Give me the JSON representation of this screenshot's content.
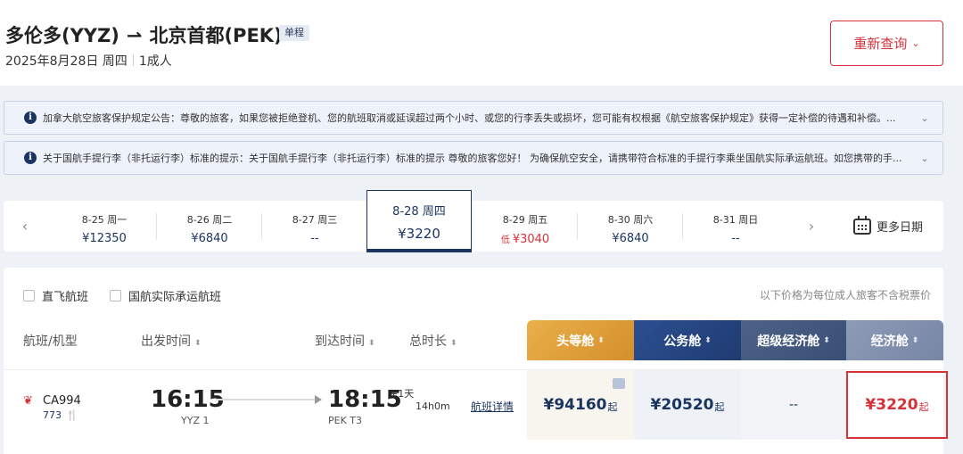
{
  "header": {
    "route_from": "多伦多(YYZ)",
    "route_arrow": "⇀",
    "route_to": "北京首都(PEK)",
    "trip_type": "单程",
    "date": "2025年8月28日 周四",
    "passengers": "1成人",
    "requery_label": "重新查询"
  },
  "notices": [
    {
      "text": "加拿大航空旅客保护规定公告：尊敬的旅客，如果您被拒绝登机、您的航班取消或延误超过两个小时、或您的行李丢失或损坏，您可能有权根据《航空旅客保护规定》获得一定补偿的待遇和补偿。..."
    },
    {
      "text": "关于国航手提行李（非托运行李）标准的提示：关于国航手提行李（非托运行李）标准的提示 尊敬的旅客您好！ 为确保航空安全，请携带符合标准的手提行李乘坐国航实际承运航班。如您携带的手..."
    }
  ],
  "dates": [
    {
      "label": "8-25 周一",
      "price": "¥12350",
      "low": false,
      "selected": false
    },
    {
      "label": "8-26 周二",
      "price": "¥6840",
      "low": false,
      "selected": false
    },
    {
      "label": "8-27 周三",
      "price": "--",
      "low": false,
      "selected": false
    },
    {
      "label": "8-28 周四",
      "price": "¥3220",
      "low": false,
      "selected": true
    },
    {
      "label": "8-29 周五",
      "price": "¥3040",
      "low": true,
      "low_tag": "低",
      "selected": false
    },
    {
      "label": "8-30 周六",
      "price": "¥6840",
      "low": false,
      "selected": false
    },
    {
      "label": "8-31 周日",
      "price": "--",
      "low": false,
      "selected": false
    }
  ],
  "more_dates_label": "更多日期",
  "filters": {
    "direct": "直飞航班",
    "operated": "国航实际承运航班",
    "price_note": "以下价格为每位成人旅客不含税票价"
  },
  "columns": {
    "flight": "航班/机型",
    "depart": "出发时间",
    "arrive": "到达时间",
    "duration": "总时长"
  },
  "cabins": [
    {
      "label": "头等舱",
      "color": "#e3a43c"
    },
    {
      "label": "公务舱",
      "color": "#2c4f92"
    },
    {
      "label": "超级经济舱",
      "color": "#43597e"
    },
    {
      "label": "经济舱",
      "color": "#8494b2"
    }
  ],
  "flight": {
    "number": "CA994",
    "aircraft": "773",
    "depart_time": "16:15",
    "depart_airport": "YYZ 1",
    "arrive_time": "18:15",
    "plus_day": "+1天",
    "arrive_airport": "PEK T3",
    "duration": "14h0m",
    "detail_link": "航班详情",
    "prices": {
      "first": "¥94160",
      "business": "¥20520",
      "premium": "--",
      "economy": "¥3220",
      "from_suffix": "起"
    }
  },
  "colors": {
    "brand_red": "#d6323a",
    "navy": "#1b3561"
  }
}
